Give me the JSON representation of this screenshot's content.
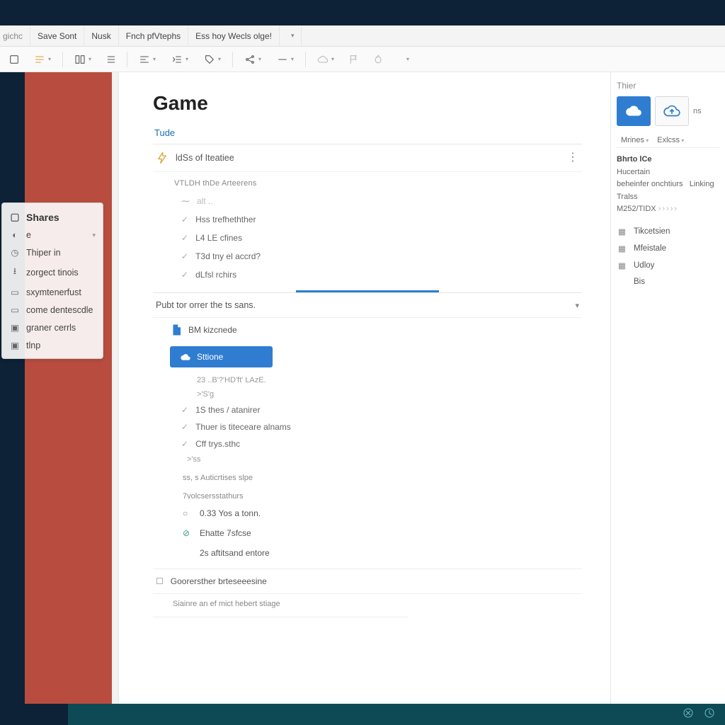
{
  "menu": {
    "items": [
      "gichc",
      "Save Sont",
      "Nusk",
      "Fnch pfVtephs",
      "Ess hoy Wecls olge!"
    ]
  },
  "page": {
    "title": "Game",
    "section1": {
      "label": "Tude"
    },
    "row1": {
      "label": "ldSs of Iteatiee"
    },
    "subhead1": "VTLDH thDe Arteerens",
    "checks1": [
      "Hss trefhethther",
      "L4 LE cfines",
      "T3d tny el accrd?",
      "dLfsl rchirs"
    ],
    "row2": {
      "label": "Pubt tor orrer the ts sans."
    },
    "file": {
      "label": "BM kizcnede"
    },
    "primary_btn": "Sttione",
    "muted1": "23 ..B'?'HD'ft' LAzE.",
    "muted2": ">'S'g",
    "checks2": [
      "1S thes / atanirer",
      "Thuer is titeceare alnams",
      "Cff trys.sthc"
    ],
    "muted3": ">'ss",
    "group1": "ss, s Auticrtises slpe",
    "group2": "7volcsersstathurs",
    "options": [
      "0.33 Yos a tonn.",
      "Ehatte 7sfcse",
      "2s aftitsand entore"
    ],
    "footer_opt": "Goorersther brteseeesine",
    "hint": "Siainre an ef mict hebert stiage"
  },
  "rpanel": {
    "title": "Thier",
    "card3_label": "ns",
    "tabs": [
      "Mrines",
      "Exlcss"
    ],
    "meta_title": "Bhrto lCe",
    "meta_lines": [
      "Hucertain",
      "beheinfer  onchtiurs",
      "Linking Tralss",
      "M252/TIDX"
    ],
    "items": [
      "Tikcetsien",
      "Mfeistale",
      "Udloy",
      "Bis"
    ]
  },
  "popup": {
    "head": "Shares",
    "items": [
      "e",
      "Thiper in",
      "zorgect tinois",
      "sxymtenerfust",
      "come dentescdle",
      "graner cerrls",
      "tlnp"
    ]
  }
}
